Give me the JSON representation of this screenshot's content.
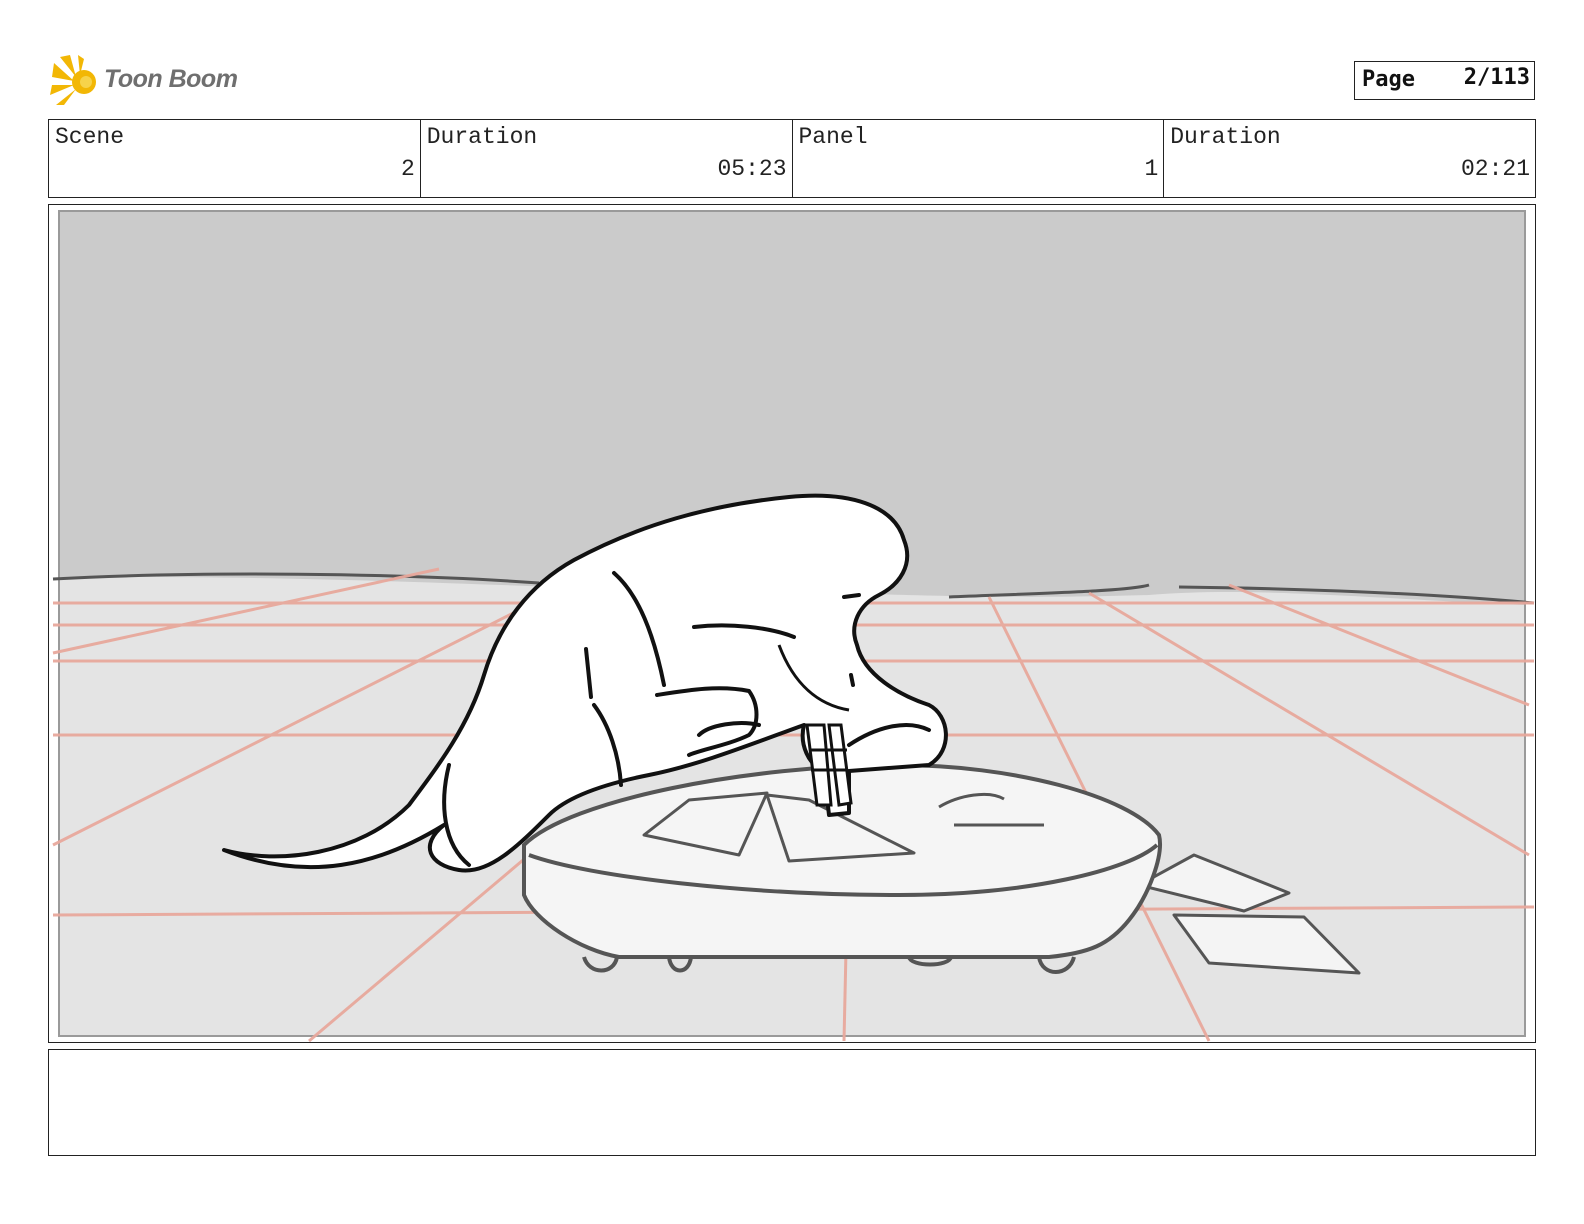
{
  "header": {
    "logo_text": "Toon Boom",
    "page_label": "Page",
    "page_number": "2/113"
  },
  "info": {
    "scene_label": "Scene",
    "scene_value": "2",
    "scene_duration_label": "Duration",
    "scene_duration_value": "05:23",
    "panel_label": "Panel",
    "panel_value": "1",
    "panel_duration_label": "Duration",
    "panel_duration_value": "02:21"
  },
  "colors": {
    "logo_burst": "#f2b705",
    "wall": "#cbcbcb",
    "floor": "#e4e4e4",
    "grid": "#e8a89c",
    "ink": "#111111"
  },
  "notes": ""
}
